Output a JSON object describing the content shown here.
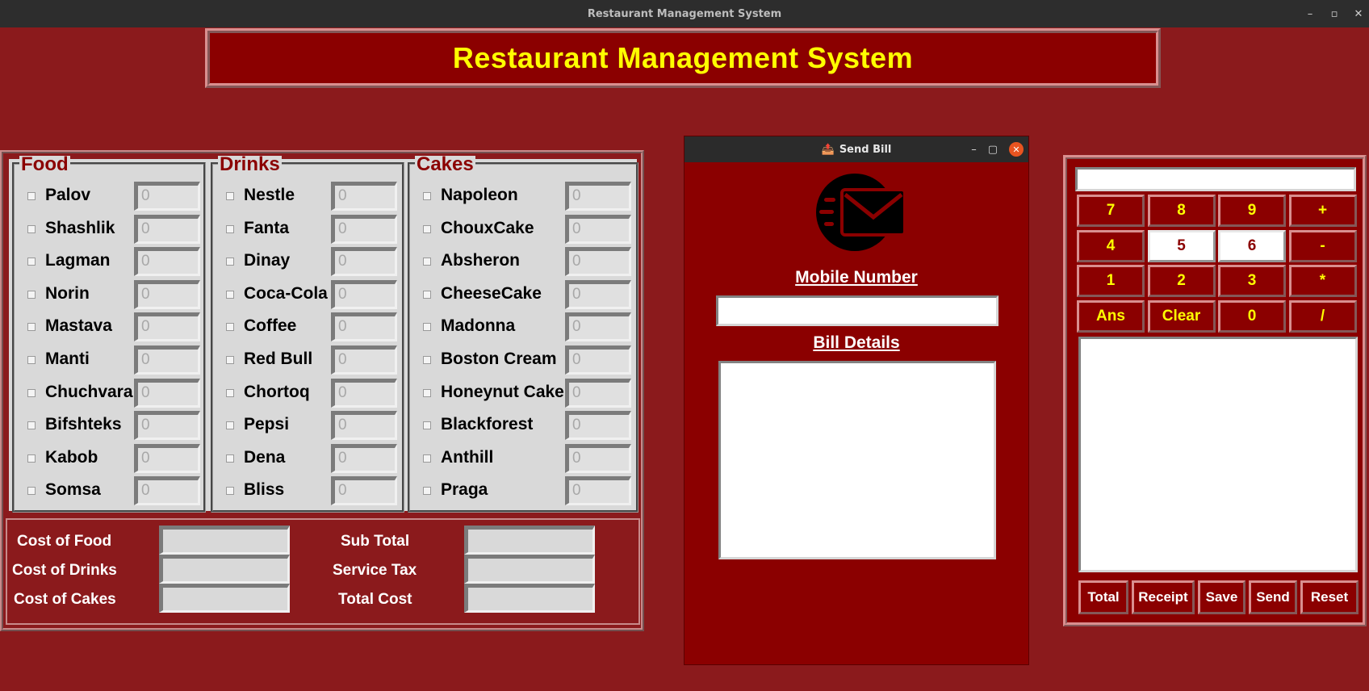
{
  "window": {
    "title": "Restaurant Management System",
    "controls": [
      "–",
      "▫",
      "✕"
    ]
  },
  "header": {
    "title": "Restaurant Management System"
  },
  "menu": {
    "food": {
      "title": "Food",
      "items": [
        {
          "name": "Palov",
          "qty": "0"
        },
        {
          "name": "Shashlik",
          "qty": "0"
        },
        {
          "name": "Lagman",
          "qty": "0"
        },
        {
          "name": "Norin",
          "qty": "0"
        },
        {
          "name": "Mastava",
          "qty": "0"
        },
        {
          "name": "Manti",
          "qty": "0"
        },
        {
          "name": "Chuchvara",
          "qty": "0"
        },
        {
          "name": "Bifshteks",
          "qty": "0"
        },
        {
          "name": "Kabob",
          "qty": "0"
        },
        {
          "name": "Somsa",
          "qty": "0"
        }
      ]
    },
    "drinks": {
      "title": "Drinks",
      "items": [
        {
          "name": "Nestle",
          "qty": "0"
        },
        {
          "name": "Fanta",
          "qty": "0"
        },
        {
          "name": "Dinay",
          "qty": "0"
        },
        {
          "name": "Coca-Cola",
          "qty": "0"
        },
        {
          "name": "Coffee",
          "qty": "0"
        },
        {
          "name": "Red Bull",
          "qty": "0"
        },
        {
          "name": "Chortoq",
          "qty": "0"
        },
        {
          "name": "Pepsi",
          "qty": "0"
        },
        {
          "name": "Dena",
          "qty": "0"
        },
        {
          "name": "Bliss",
          "qty": "0"
        }
      ]
    },
    "cakes": {
      "title": "Cakes",
      "items": [
        {
          "name": "Napoleon",
          "qty": "0"
        },
        {
          "name": "ChouxCake",
          "qty": "0"
        },
        {
          "name": "Absheron",
          "qty": "0"
        },
        {
          "name": "CheeseCake",
          "qty": "0"
        },
        {
          "name": "Madonna",
          "qty": "0"
        },
        {
          "name": "Boston Cream",
          "qty": "0"
        },
        {
          "name": "Honeynut Cake",
          "qty": "0"
        },
        {
          "name": "Blackforest",
          "qty": "0"
        },
        {
          "name": "Anthill",
          "qty": "0"
        },
        {
          "name": "Praga",
          "qty": "0"
        }
      ]
    }
  },
  "costs": {
    "cost_of_food": "Cost of Food",
    "cost_of_drinks": "Cost of Drinks",
    "cost_of_cakes": "Cost of Cakes",
    "sub_total": "Sub Total",
    "service_tax": "Service Tax",
    "total_cost": "Total Cost"
  },
  "send_bill": {
    "title": "Send Bill",
    "icon": "mail-sending-icon",
    "mobile_label": "Mobile Number",
    "mobile_value": "",
    "bill_label": "Bill Details",
    "controls": [
      "–",
      "▢",
      "✕"
    ]
  },
  "calculator": {
    "display": "",
    "keys": [
      [
        "7",
        "8",
        "9",
        "+"
      ],
      [
        "4",
        "5",
        "6",
        "-"
      ],
      [
        "1",
        "2",
        "3",
        "*"
      ],
      [
        "Ans",
        "Clear",
        "0",
        "/"
      ]
    ],
    "actions": [
      "Total",
      "Receipt",
      "Save",
      "Send",
      "Reset"
    ]
  },
  "colors": {
    "background": "#8b1a1c",
    "panel": "#8b0000",
    "title_text": "#ffff00",
    "menu_bg": "#d9d9d9"
  }
}
